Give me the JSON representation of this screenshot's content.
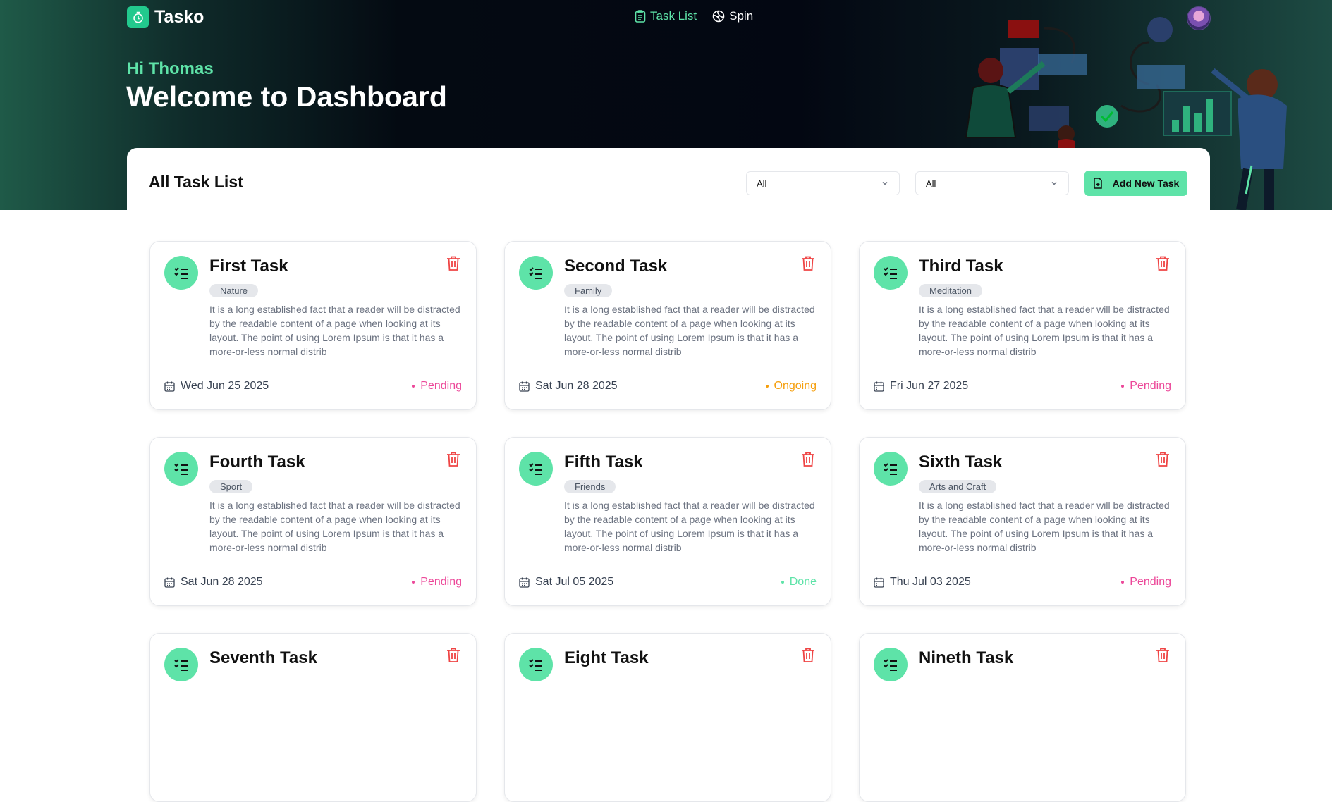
{
  "app": {
    "name": "Tasko"
  },
  "nav": {
    "links": [
      {
        "label": "Task List"
      },
      {
        "label": "Spin"
      }
    ]
  },
  "hero": {
    "greeting": "Hi Thomas",
    "title": "Welcome to Dashboard"
  },
  "panel": {
    "title": "All Task List",
    "filter1": "All",
    "filter2": "All",
    "add_button": "Add New Task"
  },
  "colors": {
    "accent": "#5ee3a8",
    "pending": "#ec4899",
    "ongoing": "#f59e0b",
    "done": "#5ee3a8",
    "delete": "#ef4444"
  },
  "tasks": [
    {
      "title": "First Task",
      "tag": "Nature",
      "desc": "It is a long established fact that a reader will be distracted by the readable content of a page when looking at its layout. The point of using Lorem Ipsum is that it has a more-or-less normal distrib",
      "date": "Wed Jun 25 2025",
      "status": "Pending",
      "status_key": "pending"
    },
    {
      "title": "Second Task",
      "tag": "Family",
      "desc": "It is a long established fact that a reader will be distracted by the readable content of a page when looking at its layout. The point of using Lorem Ipsum is that it has a more-or-less normal distrib",
      "date": "Sat Jun 28 2025",
      "status": "Ongoing",
      "status_key": "ongoing"
    },
    {
      "title": "Third Task",
      "tag": "Meditation",
      "desc": "It is a long established fact that a reader will be distracted by the readable content of a page when looking at its layout. The point of using Lorem Ipsum is that it has a more-or-less normal distrib",
      "date": "Fri Jun 27 2025",
      "status": "Pending",
      "status_key": "pending"
    },
    {
      "title": "Fourth Task",
      "tag": "Sport",
      "desc": "It is a long established fact that a reader will be distracted by the readable content of a page when looking at its layout. The point of using Lorem Ipsum is that it has a more-or-less normal distrib",
      "date": "Sat Jun 28 2025",
      "status": "Pending",
      "status_key": "pending"
    },
    {
      "title": "Fifth Task",
      "tag": "Friends",
      "desc": "It is a long established fact that a reader will be distracted by the readable content of a page when looking at its layout. The point of using Lorem Ipsum is that it has a more-or-less normal distrib",
      "date": "Sat Jul 05 2025",
      "status": "Done",
      "status_key": "done"
    },
    {
      "title": "Sixth Task",
      "tag": "Arts and Craft",
      "desc": "It is a long established fact that a reader will be distracted by the readable content of a page when looking at its layout. The point of using Lorem Ipsum is that it has a more-or-less normal distrib",
      "date": "Thu Jul 03 2025",
      "status": "Pending",
      "status_key": "pending"
    },
    {
      "title": "Seventh Task"
    },
    {
      "title": "Eight Task"
    },
    {
      "title": "Nineth Task"
    }
  ]
}
